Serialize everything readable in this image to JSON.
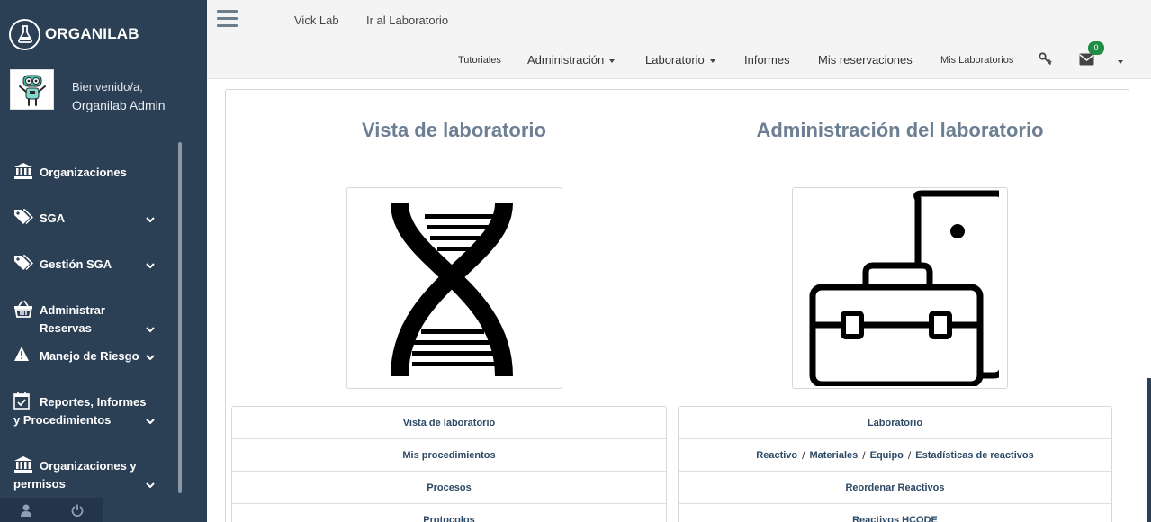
{
  "brand": {
    "name": "ORGANILAB",
    "logo_icon": "flask-icon"
  },
  "user": {
    "welcome": "Bienvenido/a,",
    "name": "Organilab Admin"
  },
  "sidebar": {
    "items": [
      {
        "label": "Organizaciones",
        "icon": "bank-icon"
      },
      {
        "label": "SGA",
        "icon": "tags-icon"
      },
      {
        "label": "Gestión SGA",
        "icon": "tags-icon"
      },
      {
        "label": "Administrar Reservas",
        "icon": "basket-icon"
      },
      {
        "label": "Manejo de Riesgo",
        "icon": "warning-icon"
      },
      {
        "label": "Reportes, Informes y Procedimientos",
        "icon": "calendar-check-icon"
      },
      {
        "label": "Organizaciones y permisos",
        "icon": "bank-icon"
      }
    ]
  },
  "topbar": {
    "lab_name": "Vick Lab",
    "go_to_lab": "Ir al Laboratorio",
    "nav": {
      "tutoriales": "Tutoriales",
      "administracion": "Administración",
      "laboratorio": "Laboratorio",
      "informes": "Informes",
      "mis_reservaciones": "Mis reservaciones",
      "mis_laboratorios": "Mis Laboratorios"
    },
    "messages_count": "0"
  },
  "main": {
    "left": {
      "title": "Vista de laboratorio",
      "image_icon": "dna-icon",
      "links": [
        "Vista de laboratorio",
        "Mis procedimientos",
        "Procesos",
        "Protocolos"
      ]
    },
    "right": {
      "title": "Administración del laboratorio",
      "image_icon": "toolbox-icon",
      "links": {
        "laboratorio": "Laboratorio",
        "reactivo": "Reactivo",
        "materiales": "Materiales",
        "equipo": "Equipo",
        "estadisticas": "Estadísticas de reactivos",
        "separator": "/",
        "reordenar": "Reordenar Reactivos",
        "hcode": "Reactivos HCODE"
      }
    }
  },
  "colors": {
    "sidebar_bg": "#2b3f55",
    "topbar_bg": "#f4f4f4",
    "title_color": "#6c7f93",
    "link_color": "#2c4966",
    "badge_bg": "#1f8d44"
  }
}
